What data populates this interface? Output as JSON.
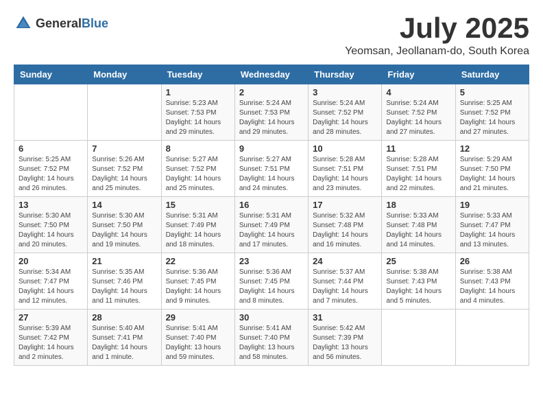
{
  "logo": {
    "general": "General",
    "blue": "Blue"
  },
  "title": {
    "month": "July 2025",
    "location": "Yeomsan, Jeollanam-do, South Korea"
  },
  "weekdays": [
    "Sunday",
    "Monday",
    "Tuesday",
    "Wednesday",
    "Thursday",
    "Friday",
    "Saturday"
  ],
  "weeks": [
    [
      {
        "day": "",
        "info": ""
      },
      {
        "day": "",
        "info": ""
      },
      {
        "day": "1",
        "info": "Sunrise: 5:23 AM\nSunset: 7:53 PM\nDaylight: 14 hours\nand 29 minutes."
      },
      {
        "day": "2",
        "info": "Sunrise: 5:24 AM\nSunset: 7:53 PM\nDaylight: 14 hours\nand 29 minutes."
      },
      {
        "day": "3",
        "info": "Sunrise: 5:24 AM\nSunset: 7:52 PM\nDaylight: 14 hours\nand 28 minutes."
      },
      {
        "day": "4",
        "info": "Sunrise: 5:24 AM\nSunset: 7:52 PM\nDaylight: 14 hours\nand 27 minutes."
      },
      {
        "day": "5",
        "info": "Sunrise: 5:25 AM\nSunset: 7:52 PM\nDaylight: 14 hours\nand 27 minutes."
      }
    ],
    [
      {
        "day": "6",
        "info": "Sunrise: 5:25 AM\nSunset: 7:52 PM\nDaylight: 14 hours\nand 26 minutes."
      },
      {
        "day": "7",
        "info": "Sunrise: 5:26 AM\nSunset: 7:52 PM\nDaylight: 14 hours\nand 25 minutes."
      },
      {
        "day": "8",
        "info": "Sunrise: 5:27 AM\nSunset: 7:52 PM\nDaylight: 14 hours\nand 25 minutes."
      },
      {
        "day": "9",
        "info": "Sunrise: 5:27 AM\nSunset: 7:51 PM\nDaylight: 14 hours\nand 24 minutes."
      },
      {
        "day": "10",
        "info": "Sunrise: 5:28 AM\nSunset: 7:51 PM\nDaylight: 14 hours\nand 23 minutes."
      },
      {
        "day": "11",
        "info": "Sunrise: 5:28 AM\nSunset: 7:51 PM\nDaylight: 14 hours\nand 22 minutes."
      },
      {
        "day": "12",
        "info": "Sunrise: 5:29 AM\nSunset: 7:50 PM\nDaylight: 14 hours\nand 21 minutes."
      }
    ],
    [
      {
        "day": "13",
        "info": "Sunrise: 5:30 AM\nSunset: 7:50 PM\nDaylight: 14 hours\nand 20 minutes."
      },
      {
        "day": "14",
        "info": "Sunrise: 5:30 AM\nSunset: 7:50 PM\nDaylight: 14 hours\nand 19 minutes."
      },
      {
        "day": "15",
        "info": "Sunrise: 5:31 AM\nSunset: 7:49 PM\nDaylight: 14 hours\nand 18 minutes."
      },
      {
        "day": "16",
        "info": "Sunrise: 5:31 AM\nSunset: 7:49 PM\nDaylight: 14 hours\nand 17 minutes."
      },
      {
        "day": "17",
        "info": "Sunrise: 5:32 AM\nSunset: 7:48 PM\nDaylight: 14 hours\nand 16 minutes."
      },
      {
        "day": "18",
        "info": "Sunrise: 5:33 AM\nSunset: 7:48 PM\nDaylight: 14 hours\nand 14 minutes."
      },
      {
        "day": "19",
        "info": "Sunrise: 5:33 AM\nSunset: 7:47 PM\nDaylight: 14 hours\nand 13 minutes."
      }
    ],
    [
      {
        "day": "20",
        "info": "Sunrise: 5:34 AM\nSunset: 7:47 PM\nDaylight: 14 hours\nand 12 minutes."
      },
      {
        "day": "21",
        "info": "Sunrise: 5:35 AM\nSunset: 7:46 PM\nDaylight: 14 hours\nand 11 minutes."
      },
      {
        "day": "22",
        "info": "Sunrise: 5:36 AM\nSunset: 7:45 PM\nDaylight: 14 hours\nand 9 minutes."
      },
      {
        "day": "23",
        "info": "Sunrise: 5:36 AM\nSunset: 7:45 PM\nDaylight: 14 hours\nand 8 minutes."
      },
      {
        "day": "24",
        "info": "Sunrise: 5:37 AM\nSunset: 7:44 PM\nDaylight: 14 hours\nand 7 minutes."
      },
      {
        "day": "25",
        "info": "Sunrise: 5:38 AM\nSunset: 7:43 PM\nDaylight: 14 hours\nand 5 minutes."
      },
      {
        "day": "26",
        "info": "Sunrise: 5:38 AM\nSunset: 7:43 PM\nDaylight: 14 hours\nand 4 minutes."
      }
    ],
    [
      {
        "day": "27",
        "info": "Sunrise: 5:39 AM\nSunset: 7:42 PM\nDaylight: 14 hours\nand 2 minutes."
      },
      {
        "day": "28",
        "info": "Sunrise: 5:40 AM\nSunset: 7:41 PM\nDaylight: 14 hours\nand 1 minute."
      },
      {
        "day": "29",
        "info": "Sunrise: 5:41 AM\nSunset: 7:40 PM\nDaylight: 13 hours\nand 59 minutes."
      },
      {
        "day": "30",
        "info": "Sunrise: 5:41 AM\nSunset: 7:40 PM\nDaylight: 13 hours\nand 58 minutes."
      },
      {
        "day": "31",
        "info": "Sunrise: 5:42 AM\nSunset: 7:39 PM\nDaylight: 13 hours\nand 56 minutes."
      },
      {
        "day": "",
        "info": ""
      },
      {
        "day": "",
        "info": ""
      }
    ]
  ]
}
